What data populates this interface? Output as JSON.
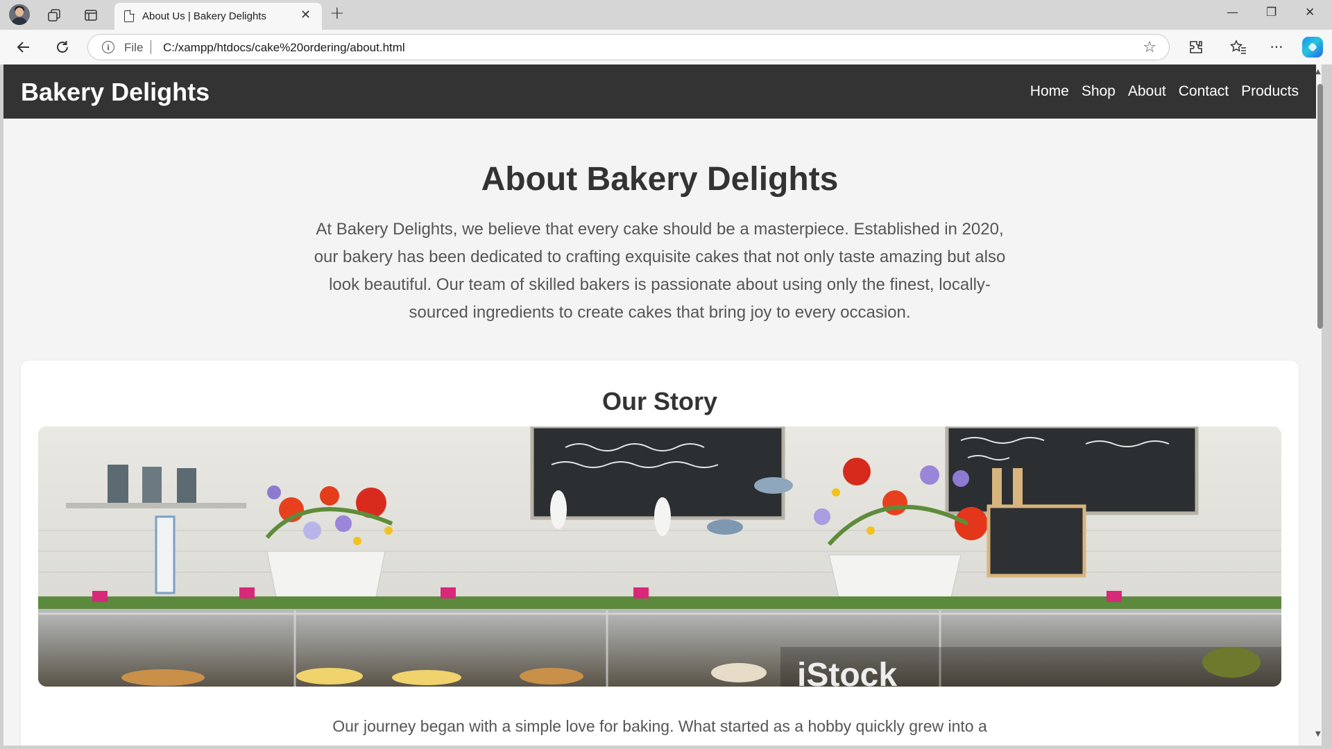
{
  "browser": {
    "tab_title": "About Us | Bakery Delights",
    "address_scheme": "File",
    "url": "C:/xampp/htdocs/cake%20ordering/about.html",
    "icons": [
      "profile-avatar",
      "workspaces-icon",
      "vertical-tabs-icon",
      "page-icon",
      "close-icon",
      "plus-icon",
      "back-arrow-icon",
      "refresh-icon",
      "info-icon",
      "star-icon",
      "extensions-icon",
      "favorites-icon",
      "more-icon",
      "copilot-icon",
      "minimize-icon",
      "restore-icon",
      "close-window-icon"
    ]
  },
  "site": {
    "brand": "Bakery Delights",
    "nav": [
      "Home",
      "Shop",
      "About",
      "Contact",
      "Products"
    ],
    "colors": {
      "header_bg": "#333333",
      "page_bg": "#f4f4f4",
      "text": "#555555"
    }
  },
  "hero": {
    "title": "About Bakery Delights",
    "text": "At Bakery Delights, we believe that every cake should be a masterpiece. Established in 2020, our bakery has been dedicated to crafting exquisite cakes that not only taste amazing but also look beautiful. Our team of skilled bakers is passionate about using only the finest, locally-sourced ingredients to create cakes that bring joy to every occasion."
  },
  "story": {
    "title": "Our Story",
    "photo_watermark": "iStock",
    "board_note": "WHY NOT TAKE ONE OF OUR DELICIOUS HAND MADE CAKES HOME WITH YOU TODAY!",
    "text": "Our journey began with a simple love for baking. What started as a hobby quickly grew into a"
  }
}
